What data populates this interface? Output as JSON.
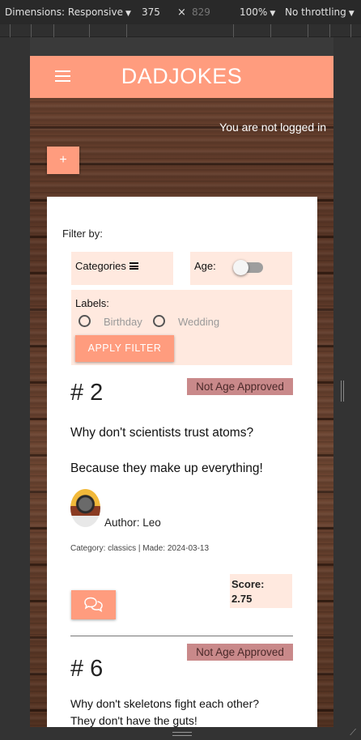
{
  "devtools": {
    "dimensions": "Dimensions: Responsive",
    "width": "375",
    "times": "×",
    "height": "829",
    "zoom": "100%",
    "throttling": "No throttling"
  },
  "app": {
    "brand": "DADJOKES",
    "login_status": "You are not logged in",
    "add_label": "+"
  },
  "filter": {
    "title": "Filter by:",
    "categories_label": "Categories",
    "age_label": "Age:",
    "age_toggle_on": false,
    "labels_title": "Labels:",
    "label_options": [
      "Birthday",
      "Wedding"
    ],
    "apply_label": "APPLY FILTER"
  },
  "jokes": [
    {
      "number": "# 2",
      "badge": "Not Age Approved",
      "question": "Why don't scientists trust atoms?",
      "answer": "Because they make up everything!",
      "author": "Author: Leo",
      "meta": "Category: classics | Made: 2024-03-13",
      "score_label": "Score:",
      "score_value": "2.75"
    },
    {
      "number": "# 6",
      "badge": "Not Age Approved",
      "question": "Why don't skeletons fight each other?",
      "answer": "They don't have the guts!"
    }
  ],
  "colors": {
    "accent": "#ff9c7e",
    "panel": "#ffe9df",
    "badge": "#c9898a"
  }
}
